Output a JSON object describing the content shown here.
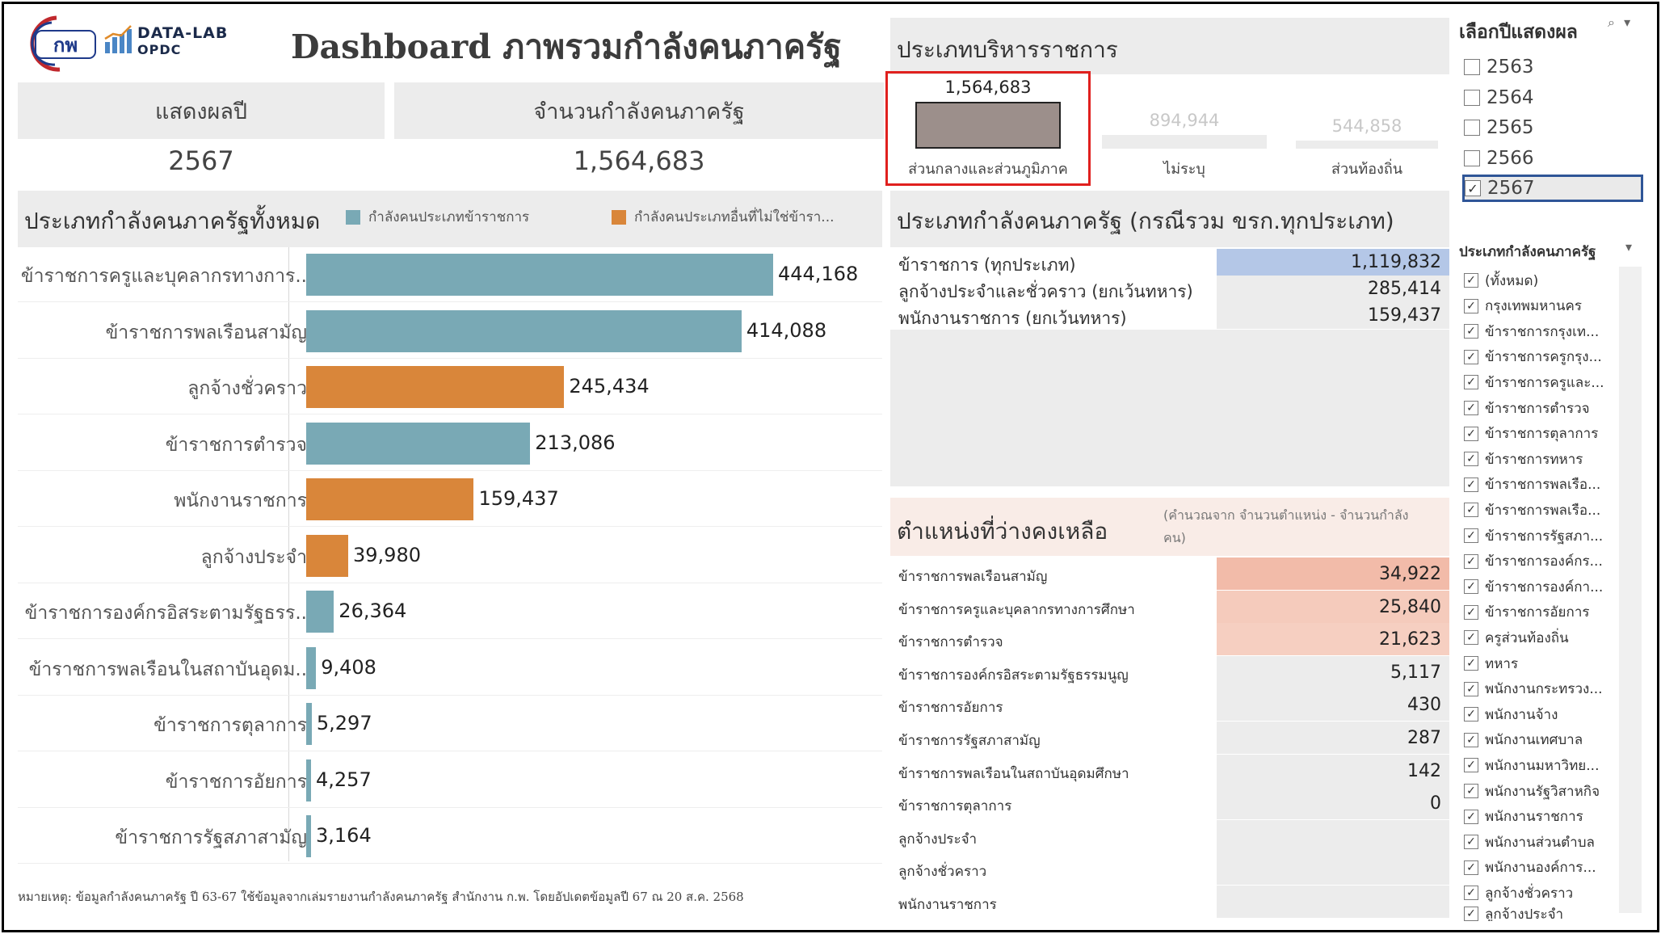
{
  "header": {
    "logo_ocsc_text": "กพ",
    "datalab_line1": "DATA-LAB",
    "datalab_line2": "OPDC",
    "title": "Dashboard ภาพรวมกำลังคนภาครัฐ"
  },
  "kpi": {
    "year_label": "แสดงผลปี",
    "year_value": "2567",
    "total_label": "จำนวนกำลังคนภาครัฐ",
    "total_value": "1,564,683"
  },
  "all_types": {
    "title": "ประเภทกำลังคนภาครัฐทั้งหมด",
    "legend": [
      {
        "label": "กำลังคนประเภทข้าราชการ",
        "color": "#79a9b5"
      },
      {
        "label": "กำลังคนประเภทอื่นที่ไม่ใช่ข้ารา...",
        "color": "#d9863a"
      }
    ],
    "footnote": "หมายเหตุ: ข้อมูลกำลังคนภาครัฐ ปี 63-67 ใช้ข้อมูลจากเล่มรายงานกำลังคนภาครัฐ สำนักงาน ก.พ. โดยอัปเดตข้อมูลปี 67 ณ 20 ส.ค. 2568"
  },
  "chart_data": {
    "type": "bar",
    "orientation": "horizontal",
    "categories": [
      "ข้าราชการครูและบุคลากรทางการ..",
      "ข้าราชการพลเรือนสามัญ",
      "ลูกจ้างชั่วคราว",
      "ข้าราชการตำรวจ",
      "พนักงานราชการ",
      "ลูกจ้างประจำ",
      "ข้าราชการองค์กรอิสระตามรัฐธรร..",
      "ข้าราชการพลเรือนในสถาบันอุดม..",
      "ข้าราชการตุลาการ",
      "ข้าราชการอัยการ",
      "ข้าราชการรัฐสภาสามัญ"
    ],
    "values": [
      444168,
      414088,
      245434,
      213086,
      159437,
      39980,
      26364,
      9408,
      5297,
      4257,
      3164
    ],
    "value_labels": [
      "444,168",
      "414,088",
      "245,434",
      "213,086",
      "159,437",
      "39,980",
      "26,364",
      "9,408",
      "5,297",
      "4,257",
      "3,164"
    ],
    "group": [
      "civil",
      "civil",
      "other",
      "civil",
      "other",
      "other",
      "civil",
      "civil",
      "civil",
      "civil",
      "civil"
    ],
    "colors": {
      "civil": "#79a9b5",
      "other": "#d9863a"
    },
    "xlim": [
      0,
      444168
    ]
  },
  "admin_types": {
    "title": "ประเภทบริหารราชการ",
    "items": [
      {
        "label": "ส่วนกลางและส่วนภูมิภาค",
        "value": 1564683,
        "value_label": "1,564,683",
        "color": "#9c8f8b",
        "active": true
      },
      {
        "label": "ไม่ระบุ",
        "value": 894944,
        "value_label": "894,944",
        "color": "#ececec",
        "active": false
      },
      {
        "label": "ส่วนท้องถิ่น",
        "value": 544858,
        "value_label": "544,858",
        "color": "#ececec",
        "active": false
      }
    ]
  },
  "workforce_types": {
    "title": "ประเภทกำลังคนภาครัฐ (กรณีรวม ขรก.ทุกประเภท)",
    "rows": [
      {
        "label": "ข้าราชการ (ทุกประเภท)",
        "value": "1,119,832",
        "color": "#b4c7e7"
      },
      {
        "label": "ลูกจ้างประจำและชั่วคราว (ยกเว้นทหาร)",
        "value": "285,414",
        "color": "#ececec"
      },
      {
        "label": "พนักงานราชการ (ยกเว้นทหาร)",
        "value": "159,437",
        "color": "#ececec"
      }
    ]
  },
  "vacancies": {
    "title": "ตำแหน่งที่ว่างคงเหลือ",
    "note_line1": "(คำนวณจาก จำนวนตำแหน่ง - จำนวนกำลัง",
    "note_line2": "คน)",
    "rows": [
      {
        "label": "ข้าราชการพลเรือนสามัญ",
        "value": "34,922",
        "color": "#f2bba9"
      },
      {
        "label": "ข้าราชการครูและบุคลากรทางการศึกษา",
        "value": "25,840",
        "color": "#f5cbbc"
      },
      {
        "label": "ข้าราชการตำรวจ",
        "value": "21,623",
        "color": "#f6cfc1"
      },
      {
        "label": "ข้าราชการองค์กรอิสระตามรัฐธรรมนูญ",
        "value": "5,117",
        "color": "#ececec"
      },
      {
        "label": "ข้าราชการอัยการ",
        "value": "430",
        "color": "#ececec"
      },
      {
        "label": "ข้าราชการรัฐสภาสามัญ",
        "value": "287",
        "color": "#ececec"
      },
      {
        "label": "ข้าราชการพลเรือนในสถาบันอุดมศึกษา",
        "value": "142",
        "color": "#ececec"
      },
      {
        "label": "ข้าราชการตุลาการ",
        "value": "0",
        "color": "#ececec"
      },
      {
        "label": "ลูกจ้างประจำ",
        "value": "",
        "color": "#ececec"
      },
      {
        "label": "ลูกจ้างชั่วคราว",
        "value": "",
        "color": "#ececec"
      },
      {
        "label": "พนักงานราชการ",
        "value": "",
        "color": "#ececec"
      }
    ]
  },
  "year_filter": {
    "title": "เลือกปีแสดงผล",
    "items": [
      {
        "label": "2563",
        "checked": false
      },
      {
        "label": "2564",
        "checked": false
      },
      {
        "label": "2565",
        "checked": false
      },
      {
        "label": "2566",
        "checked": false
      },
      {
        "label": "2567",
        "checked": true
      }
    ]
  },
  "type_filter": {
    "title": "ประเภทกำลังคนภาครัฐ",
    "items": [
      "(ทั้งหมด)",
      "กรุงเทพมหานคร",
      "ข้าราชการกรุงเท...",
      "ข้าราชการครูกรุง...",
      "ข้าราชการครูและ...",
      "ข้าราชการตำรวจ",
      "ข้าราชการตุลาการ",
      "ข้าราชการทหาร",
      "ข้าราชการพลเรือ...",
      "ข้าราชการพลเรือ...",
      "ข้าราชการรัฐสภา...",
      "ข้าราชการองค์กร...",
      "ข้าราชการองค์กา...",
      "ข้าราชการอัยการ",
      "ครูส่วนท้องถิ่น",
      "ทหาร",
      "พนักงานกระทรวง...",
      "พนักงานจ้าง",
      "พนักงานเทศบาล",
      "พนักงานมหาวิทย...",
      "พนักงานรัฐวิสาหกิจ",
      "พนักงานราชการ",
      "พนักงานส่วนตำบล",
      "พนักงานองค์การ...",
      "ลูกจ้างชั่วคราว",
      "ลูกจ้างประจำ"
    ]
  }
}
